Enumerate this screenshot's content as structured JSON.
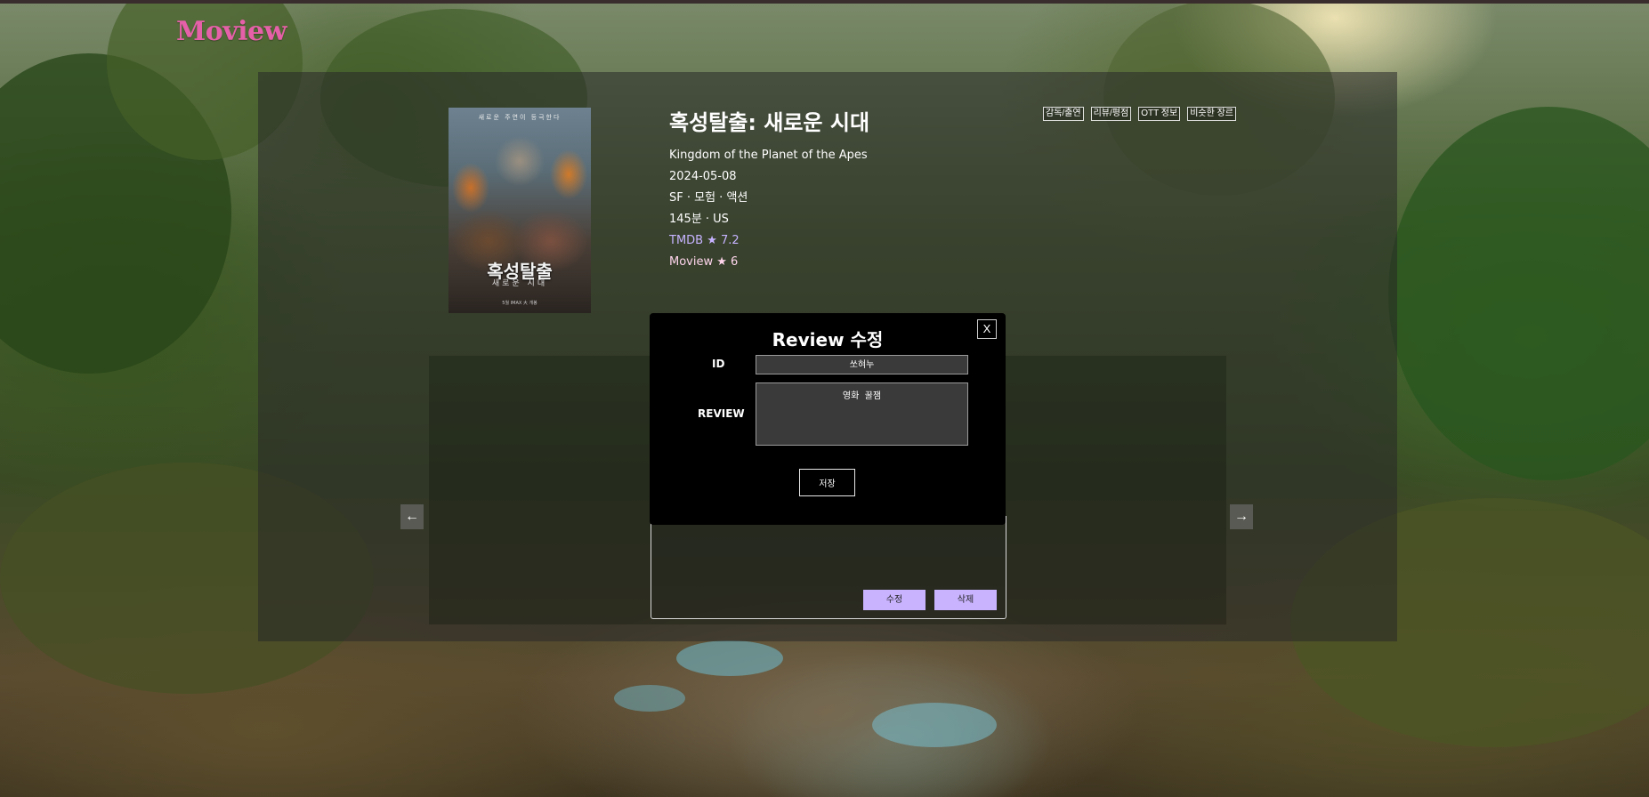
{
  "app": {
    "logo": "Moview"
  },
  "movie": {
    "poster": {
      "tagline": "새로운 주연이 등극한다",
      "title": "혹성탈출",
      "subtitle": "새로운 시대",
      "footer": "5월 IMAX 大 개봉"
    },
    "title": "혹성탈출: 새로운 시대",
    "original_title": "Kingdom of the Planet of the Apes",
    "release_date": "2024-05-08",
    "genres": "SF · 모험 · 액션",
    "runtime_country": "145분 · US",
    "tmdb_rating": "TMDB ★ 7.2",
    "moview_rating": "Moview ★ 6"
  },
  "tabs": [
    {
      "label": "감독/출연"
    },
    {
      "label": "리뷰/평점"
    },
    {
      "label": "OTT 정보"
    },
    {
      "label": "비슷한 장르"
    }
  ],
  "carousel": {
    "prev": "←",
    "next": "→"
  },
  "review_card": {
    "edit_label": "수정",
    "delete_label": "삭제"
  },
  "modal": {
    "title": "Review 수정",
    "close_label": "X",
    "id_label": "ID",
    "id_value": "쏘혀누",
    "review_label": "REVIEW",
    "review_value": "영화  꿀잼",
    "save_label": "저장"
  },
  "colors": {
    "logo": "#e560a8",
    "accent_button": "#c9b3ff",
    "tmdb_text": "#c6b3ff",
    "moview_text": "#ffd5ec",
    "modal_bg": "#000000"
  }
}
